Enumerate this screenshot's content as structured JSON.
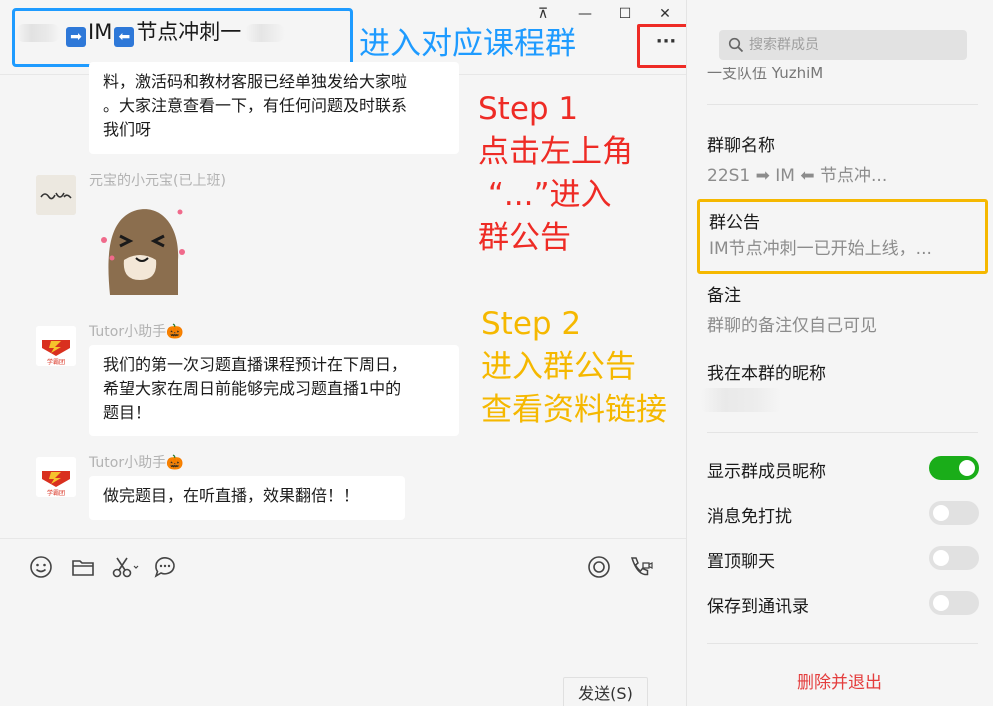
{
  "chat": {
    "title_prefix_emoji1": "➡",
    "title_im": "IM",
    "title_prefix_emoji2": "⬅",
    "title_suffix": "节点冲刺一",
    "title_annotation": "进入对应课程群",
    "more_label": "···",
    "window_controls": {
      "pin": "⊼",
      "minimize": "—",
      "maximize": "☐",
      "close": "✕"
    }
  },
  "messages": [
    {
      "id": "m1",
      "text_line1": "料，激活码和教材客服已经单独发给大家啦",
      "text_line2": "。大家注意查看一下，有任何问题及时联系",
      "text_line3": "我们呀"
    },
    {
      "id": "m2",
      "sender": "元宝的小元宝(已上班)",
      "avatar_text": "金元宝",
      "sticker": "sticker"
    },
    {
      "id": "m3",
      "sender": "Tutor小助手🎃",
      "avatar_text": "学霸团",
      "text_line1": "我们的第一次习题直播课程预计在下周日，",
      "text_line2": "希望大家在周日前能够完成习题直播1中的",
      "text_line3": "题目！"
    },
    {
      "id": "m4",
      "sender": "Tutor小助手🎃",
      "avatar_text": "学霸团",
      "text_line1": "做完题目，在听直播，效果翻倍！！"
    }
  ],
  "annotations": {
    "step1": "Step 1\n点击左上角\n “...”进入\n群公告",
    "step2": "Step 2\n进入群公告\n查看资料链接"
  },
  "composer": {
    "tools": [
      "emoji-icon",
      "folder-icon",
      "scissors-icon",
      "chat-bubble-icon"
    ],
    "right_tools": [
      "live-icon",
      "video-call-icon"
    ],
    "send_label": "发送(S)"
  },
  "side": {
    "search_placeholder": "搜索群成员",
    "member_cut": "一支队伍  YuzhiM",
    "group_name_label": "群聊名称",
    "group_name_value": "22S1 ➡ IM ⬅ 节点冲...",
    "notice_label": "群公告",
    "notice_value": "IM节点冲刺一已开始上线，...",
    "remark_label": "备注",
    "remark_value": "群聊的备注仅自己可见",
    "my_nickname_label": "我在本群的昵称",
    "settings": [
      {
        "label": "显示群成员昵称",
        "on": true
      },
      {
        "label": "消息免打扰",
        "on": false
      },
      {
        "label": "置顶聊天",
        "on": false
      },
      {
        "label": "保存到通讯录",
        "on": false
      }
    ],
    "quit_label": "删除并退出"
  },
  "colors": {
    "accent_blue": "#1e9bff",
    "annotation_red": "#ee2b25",
    "annotation_yellow": "#f5b800",
    "toggle_on": "#1aad19",
    "danger": "#e43d3d"
  }
}
